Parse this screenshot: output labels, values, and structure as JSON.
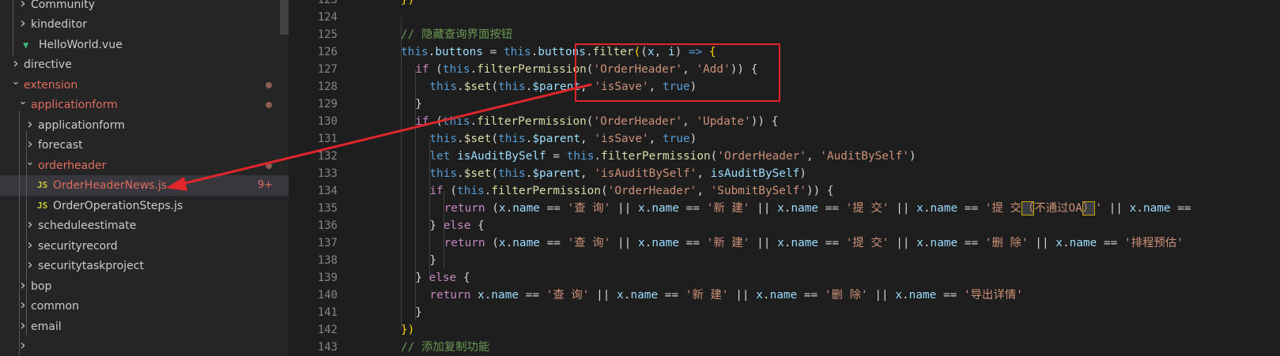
{
  "explorer": {
    "rows": [
      {
        "label": "Community",
        "indent": 1,
        "type": "folder",
        "collapsed": true,
        "color": "#cccccc"
      },
      {
        "label": "kindeditor",
        "indent": 1,
        "type": "folder",
        "collapsed": true,
        "color": "#cccccc"
      },
      {
        "label": "HelloWorld.vue",
        "indent": 1,
        "type": "vue",
        "color": "#cccccc"
      },
      {
        "label": "directive",
        "indent": 0,
        "type": "folder",
        "collapsed": true,
        "color": "#cccccc"
      },
      {
        "label": "extension",
        "indent": 0,
        "type": "folder",
        "collapsed": false,
        "color": "#e06c5f",
        "dot": true
      },
      {
        "label": "applicationform",
        "indent": 1,
        "type": "folder",
        "collapsed": false,
        "color": "#e06c5f",
        "dot": true
      },
      {
        "label": "applicationform",
        "indent": 2,
        "type": "folder",
        "collapsed": true,
        "color": "#cccccc"
      },
      {
        "label": "forecast",
        "indent": 2,
        "type": "folder",
        "collapsed": true,
        "color": "#cccccc"
      },
      {
        "label": "orderheader",
        "indent": 2,
        "type": "folder",
        "collapsed": false,
        "color": "#e06c5f",
        "dot": true
      },
      {
        "label": "OrderHeaderNews.js",
        "indent": 3,
        "type": "js",
        "color": "#e06c5f",
        "badge": "9+",
        "selected": true
      },
      {
        "label": "OrderOperationSteps.js",
        "indent": 3,
        "type": "js",
        "color": "#cccccc"
      },
      {
        "label": "scheduleestimate",
        "indent": 2,
        "type": "folder",
        "collapsed": true,
        "color": "#cccccc"
      },
      {
        "label": "securityrecord",
        "indent": 2,
        "type": "folder",
        "collapsed": true,
        "color": "#cccccc"
      },
      {
        "label": "securitytaskproject",
        "indent": 2,
        "type": "folder",
        "collapsed": true,
        "color": "#cccccc"
      },
      {
        "label": "bop",
        "indent": 1,
        "type": "folder",
        "collapsed": true,
        "color": "#cccccc"
      },
      {
        "label": "common",
        "indent": 1,
        "type": "folder",
        "collapsed": true,
        "color": "#cccccc"
      },
      {
        "label": "email",
        "indent": 1,
        "type": "folder",
        "collapsed": true,
        "color": "#cccccc"
      },
      {
        "label": "",
        "indent": 1,
        "type": "folder",
        "collapsed": true,
        "color": "#cccccc"
      }
    ],
    "icons": {
      "folder_collapsed": "chevron-right-icon",
      "folder_expanded": "chevron-down-icon",
      "vue": "vue-file-icon",
      "js": "js-file-icon"
    }
  },
  "editor": {
    "colors": {
      "keyword": "#569cd6",
      "control": "#c586c0",
      "function": "#dcdcaa",
      "variable": "#9cdcfe",
      "string": "#ce9178",
      "comment": "#6a9955",
      "bracket": "#ffd700",
      "plain": "#d4d4d4"
    },
    "lines": [
      {
        "num": "123",
        "indent": 0,
        "tokens": [
          [
            "b",
            "})"
          ]
        ]
      },
      {
        "num": "124",
        "indent": 0,
        "tokens": []
      },
      {
        "num": "125",
        "indent": 0,
        "tokens": [
          [
            "c",
            "// 隐藏查询界面按钮"
          ]
        ]
      },
      {
        "num": "126",
        "indent": 0,
        "tokens": [
          [
            "k",
            "this"
          ],
          [
            "p",
            "."
          ],
          [
            "v",
            "buttons"
          ],
          [
            "p",
            " = "
          ],
          [
            "k",
            "this"
          ],
          [
            "p",
            "."
          ],
          [
            "v",
            "buttons"
          ],
          [
            "p",
            "."
          ],
          [
            "f",
            "filter"
          ],
          [
            "b",
            "("
          ],
          [
            "p",
            "("
          ],
          [
            "v",
            "x"
          ],
          [
            "p",
            ", "
          ],
          [
            "v",
            "i"
          ],
          [
            "p",
            ") "
          ],
          [
            "k",
            "=>"
          ],
          [
            "p",
            " "
          ],
          [
            "b",
            "{"
          ]
        ]
      },
      {
        "num": "127",
        "indent": 1,
        "tokens": [
          [
            "x",
            "if"
          ],
          [
            "p",
            " ("
          ],
          [
            "k",
            "this"
          ],
          [
            "p",
            "."
          ],
          [
            "f",
            "filterPermission"
          ],
          [
            "p",
            "("
          ],
          [
            "s",
            "'OrderHeader'"
          ],
          [
            "p",
            ", "
          ],
          [
            "s",
            "'Add'"
          ],
          [
            "p",
            "))"
          ],
          [
            "p",
            " {"
          ]
        ]
      },
      {
        "num": "128",
        "indent": 2,
        "tokens": [
          [
            "k",
            "this"
          ],
          [
            "p",
            "."
          ],
          [
            "f",
            "$set"
          ],
          [
            "p",
            "("
          ],
          [
            "k",
            "this"
          ],
          [
            "p",
            "."
          ],
          [
            "v",
            "$parent"
          ],
          [
            "p",
            ", "
          ],
          [
            "s",
            "'isSave'"
          ],
          [
            "p",
            ", "
          ],
          [
            "k",
            "true"
          ],
          [
            "p",
            ")"
          ]
        ]
      },
      {
        "num": "129",
        "indent": 1,
        "tokens": [
          [
            "p",
            "}"
          ]
        ]
      },
      {
        "num": "130",
        "indent": 1,
        "tokens": [
          [
            "x",
            "if"
          ],
          [
            "p",
            " ("
          ],
          [
            "k",
            "this"
          ],
          [
            "p",
            "."
          ],
          [
            "f",
            "filterPermission"
          ],
          [
            "p",
            "("
          ],
          [
            "s",
            "'OrderHeader'"
          ],
          [
            "p",
            ", "
          ],
          [
            "s",
            "'Update'"
          ],
          [
            "p",
            "))"
          ],
          [
            "p",
            " {"
          ]
        ]
      },
      {
        "num": "131",
        "indent": 2,
        "tokens": [
          [
            "k",
            "this"
          ],
          [
            "p",
            "."
          ],
          [
            "f",
            "$set"
          ],
          [
            "p",
            "("
          ],
          [
            "k",
            "this"
          ],
          [
            "p",
            "."
          ],
          [
            "v",
            "$parent"
          ],
          [
            "p",
            ", "
          ],
          [
            "s",
            "'isSave'"
          ],
          [
            "p",
            ", "
          ],
          [
            "k",
            "true"
          ],
          [
            "p",
            ")"
          ]
        ]
      },
      {
        "num": "132",
        "indent": 2,
        "tokens": [
          [
            "k",
            "let"
          ],
          [
            "p",
            " "
          ],
          [
            "v",
            "isAuditBySelf"
          ],
          [
            "p",
            " = "
          ],
          [
            "k",
            "this"
          ],
          [
            "p",
            "."
          ],
          [
            "f",
            "filterPermission"
          ],
          [
            "p",
            "("
          ],
          [
            "s",
            "'OrderHeader'"
          ],
          [
            "p",
            ", "
          ],
          [
            "s",
            "'AuditBySelf'"
          ],
          [
            "p",
            ")"
          ]
        ]
      },
      {
        "num": "133",
        "indent": 2,
        "tokens": [
          [
            "k",
            "this"
          ],
          [
            "p",
            "."
          ],
          [
            "f",
            "$set"
          ],
          [
            "p",
            "("
          ],
          [
            "k",
            "this"
          ],
          [
            "p",
            "."
          ],
          [
            "v",
            "$parent"
          ],
          [
            "p",
            ", "
          ],
          [
            "s",
            "'isAuditBySelf'"
          ],
          [
            "p",
            ", "
          ],
          [
            "v",
            "isAuditBySelf"
          ],
          [
            "p",
            ")"
          ]
        ]
      },
      {
        "num": "134",
        "indent": 2,
        "tokens": [
          [
            "x",
            "if"
          ],
          [
            "p",
            " ("
          ],
          [
            "k",
            "this"
          ],
          [
            "p",
            "."
          ],
          [
            "f",
            "filterPermission"
          ],
          [
            "p",
            "("
          ],
          [
            "s",
            "'OrderHeader'"
          ],
          [
            "p",
            ", "
          ],
          [
            "s",
            "'SubmitBySelf'"
          ],
          [
            "p",
            "))"
          ],
          [
            "p",
            " {"
          ]
        ]
      },
      {
        "num": "135",
        "indent": 3,
        "tokens": [
          [
            "x",
            "return"
          ],
          [
            "p",
            " ("
          ],
          [
            "v",
            "x"
          ],
          [
            "p",
            "."
          ],
          [
            "v",
            "name"
          ],
          [
            "p",
            " == "
          ],
          [
            "s",
            "'查 询'"
          ],
          [
            "p",
            " || "
          ],
          [
            "v",
            "x"
          ],
          [
            "p",
            "."
          ],
          [
            "v",
            "name"
          ],
          [
            "p",
            " == "
          ],
          [
            "s",
            "'新 建'"
          ],
          [
            "p",
            " || "
          ],
          [
            "v",
            "x"
          ],
          [
            "p",
            "."
          ],
          [
            "v",
            "name"
          ],
          [
            "p",
            " == "
          ],
          [
            "s",
            "'提 交'"
          ],
          [
            "p",
            " || "
          ],
          [
            "v",
            "x"
          ],
          [
            "p",
            "."
          ],
          [
            "v",
            "name"
          ],
          [
            "p",
            " == "
          ],
          [
            "s",
            "'提 交"
          ],
          [
            "h",
            "（"
          ],
          [
            "s",
            "不通过OA"
          ],
          [
            "h",
            "）"
          ],
          [
            "s",
            "'"
          ],
          [
            "p",
            " || "
          ],
          [
            "v",
            "x"
          ],
          [
            "p",
            "."
          ],
          [
            "v",
            "name"
          ],
          [
            "p",
            " =="
          ]
        ]
      },
      {
        "num": "136",
        "indent": 2,
        "tokens": [
          [
            "p",
            "} "
          ],
          [
            "x",
            "else"
          ],
          [
            "p",
            " {"
          ]
        ]
      },
      {
        "num": "137",
        "indent": 3,
        "tokens": [
          [
            "x",
            "return"
          ],
          [
            "p",
            " ("
          ],
          [
            "v",
            "x"
          ],
          [
            "p",
            "."
          ],
          [
            "v",
            "name"
          ],
          [
            "p",
            " == "
          ],
          [
            "s",
            "'查 询'"
          ],
          [
            "p",
            " || "
          ],
          [
            "v",
            "x"
          ],
          [
            "p",
            "."
          ],
          [
            "v",
            "name"
          ],
          [
            "p",
            " == "
          ],
          [
            "s",
            "'新 建'"
          ],
          [
            "p",
            " || "
          ],
          [
            "v",
            "x"
          ],
          [
            "p",
            "."
          ],
          [
            "v",
            "name"
          ],
          [
            "p",
            " == "
          ],
          [
            "s",
            "'提 交'"
          ],
          [
            "p",
            " || "
          ],
          [
            "v",
            "x"
          ],
          [
            "p",
            "."
          ],
          [
            "v",
            "name"
          ],
          [
            "p",
            " == "
          ],
          [
            "s",
            "'删 除'"
          ],
          [
            "p",
            " || "
          ],
          [
            "v",
            "x"
          ],
          [
            "p",
            "."
          ],
          [
            "v",
            "name"
          ],
          [
            "p",
            " == "
          ],
          [
            "s",
            "'排程预估'"
          ]
        ]
      },
      {
        "num": "138",
        "indent": 2,
        "tokens": [
          [
            "p",
            "}"
          ]
        ]
      },
      {
        "num": "139",
        "indent": 1,
        "tokens": [
          [
            "p",
            "} "
          ],
          [
            "x",
            "else"
          ],
          [
            "p",
            " {"
          ]
        ]
      },
      {
        "num": "140",
        "indent": 2,
        "tokens": [
          [
            "x",
            "return"
          ],
          [
            "p",
            " "
          ],
          [
            "v",
            "x"
          ],
          [
            "p",
            "."
          ],
          [
            "v",
            "name"
          ],
          [
            "p",
            " == "
          ],
          [
            "s",
            "'查 询'"
          ],
          [
            "p",
            " || "
          ],
          [
            "v",
            "x"
          ],
          [
            "p",
            "."
          ],
          [
            "v",
            "name"
          ],
          [
            "p",
            " == "
          ],
          [
            "s",
            "'新 建'"
          ],
          [
            "p",
            " || "
          ],
          [
            "v",
            "x"
          ],
          [
            "p",
            "."
          ],
          [
            "v",
            "name"
          ],
          [
            "p",
            " == "
          ],
          [
            "s",
            "'删 除'"
          ],
          [
            "p",
            " || "
          ],
          [
            "v",
            "x"
          ],
          [
            "p",
            "."
          ],
          [
            "v",
            "name"
          ],
          [
            "p",
            " == "
          ],
          [
            "s",
            "'导出详情'"
          ]
        ]
      },
      {
        "num": "141",
        "indent": 1,
        "tokens": [
          [
            "p",
            "}"
          ]
        ]
      },
      {
        "num": "142",
        "indent": 0,
        "tokens": [
          [
            "b",
            "})"
          ]
        ]
      },
      {
        "num": "143",
        "indent": 0,
        "tokens": [
          [
            "c",
            "// 添加复制功能"
          ]
        ]
      }
    ]
  },
  "annotation": {
    "box_color": "#e0262a",
    "arrow_color": "#e0262a"
  }
}
